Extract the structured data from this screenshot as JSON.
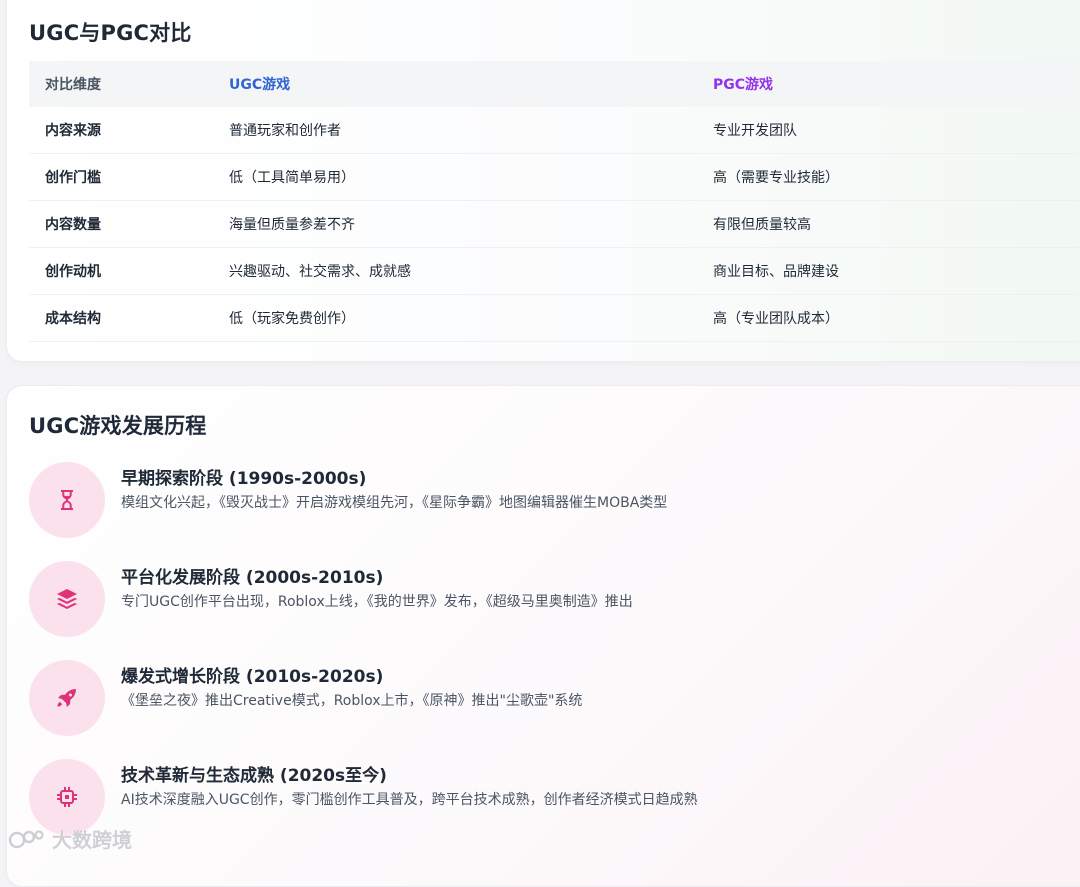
{
  "comparison": {
    "title": "UGC与PGC对比",
    "headers": {
      "dimension": "对比维度",
      "ugc": "UGC游戏",
      "pgc": "PGC游戏"
    },
    "rows": [
      {
        "dimension": "内容来源",
        "ugc": "普通玩家和创作者",
        "pgc": "专业开发团队"
      },
      {
        "dimension": "创作门槛",
        "ugc": "低（工具简单易用）",
        "pgc": "高（需要专业技能）"
      },
      {
        "dimension": "内容数量",
        "ugc": "海量但质量参差不齐",
        "pgc": "有限但质量较高"
      },
      {
        "dimension": "创作动机",
        "ugc": "兴趣驱动、社交需求、成就感",
        "pgc": "商业目标、品牌建设"
      },
      {
        "dimension": "成本结构",
        "ugc": "低（玩家免费创作）",
        "pgc": "高（专业团队成本）"
      }
    ],
    "colors": {
      "ugc": "#2f63d4",
      "pgc": "#9333ea"
    }
  },
  "timeline": {
    "title": "UGC游戏发展历程",
    "accent": "#e0317a",
    "items": [
      {
        "icon": "hourglass-icon",
        "title": "早期探索阶段 (1990s-2000s)",
        "desc": "模组文化兴起，《毁灭战士》开启游戏模组先河，《星际争霸》地图编辑器催生MOBA类型"
      },
      {
        "icon": "layers-icon",
        "title": "平台化发展阶段 (2000s-2010s)",
        "desc": "专门UGC创作平台出现，Roblox上线，《我的世界》发布，《超级马里奥制造》推出"
      },
      {
        "icon": "rocket-icon",
        "title": "爆发式增长阶段 (2010s-2020s)",
        "desc": "《堡垒之夜》推出Creative模式，Roblox上市，《原神》推出\"尘歌壶\"系统"
      },
      {
        "icon": "chip-icon",
        "title": "技术革新与生态成熟 (2020s至今)",
        "desc": "AI技术深度融入UGC创作，零门槛创作工具普及，跨平台技术成熟，创作者经济模式日趋成熟"
      }
    ]
  },
  "watermark": {
    "text": "大数跨境"
  }
}
